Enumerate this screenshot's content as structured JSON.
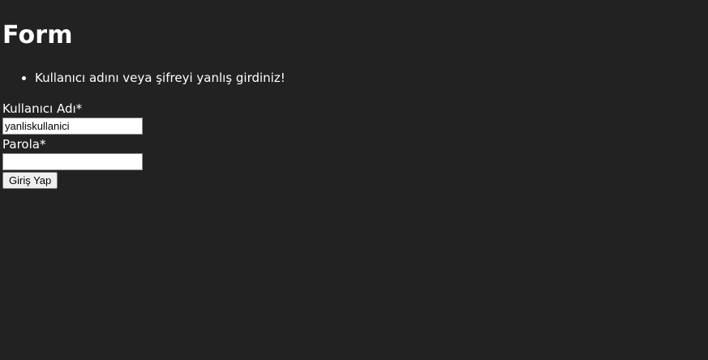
{
  "page": {
    "title": "Form"
  },
  "errors": [
    "Kullanıcı adını veya şifreyi yanlış girdiniz!"
  ],
  "form": {
    "username_label": "Kullanıcı Adı*",
    "username_value": "yanliskullanici",
    "password_label": "Parola*",
    "password_value": "",
    "submit_label": "Giriş Yap"
  }
}
